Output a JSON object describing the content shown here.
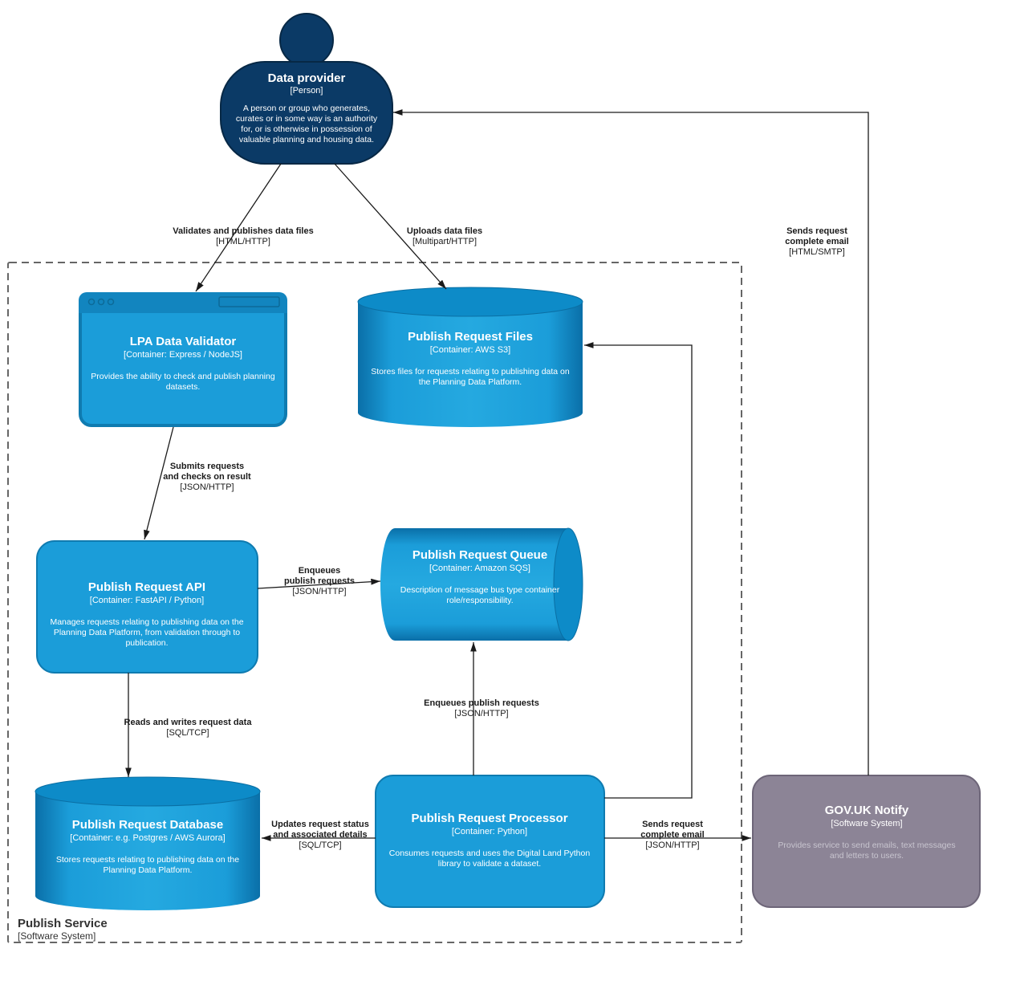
{
  "boundary": {
    "title": "Publish Service",
    "subtitle": "[Software System]"
  },
  "person": {
    "title": "Data provider",
    "subtitle": "[Person]",
    "desc1": "A person or group who generates,",
    "desc2": "curates or in some way is an authority",
    "desc3": "for, or is otherwise in possession of",
    "desc4": "valuable planning and housing data."
  },
  "validator": {
    "title": "LPA Data Validator",
    "subtitle": "[Container: Express / NodeJS]",
    "desc1": "Provides the ability to check and publish planning",
    "desc2": "datasets."
  },
  "files": {
    "title": "Publish Request Files",
    "subtitle": "[Container: AWS S3]",
    "desc1": "Stores files for requests relating to publishing data on",
    "desc2": "the Planning Data Platform."
  },
  "api": {
    "title": "Publish Request API",
    "subtitle": "[Container: FastAPI / Python]",
    "desc1": "Manages requests relating to publishing data on the",
    "desc2": "Planning Data Platform, from validation through to",
    "desc3": "publication."
  },
  "queue": {
    "title": "Publish Request Queue",
    "subtitle": "[Container: Amazon SQS]",
    "desc1": "Description of message bus type container",
    "desc2": "role/responsibility."
  },
  "db": {
    "title": "Publish Request Database",
    "subtitle": "[Container: e.g. Postgres / AWS Aurora]",
    "desc1": "Stores requests relating to publishing data on the",
    "desc2": "Planning Data Platform."
  },
  "processor": {
    "title": "Publish Request Processor",
    "subtitle": "[Container: Python]",
    "desc1": "Consumes requests and uses the Digital Land Python",
    "desc2": "library to validate a dataset."
  },
  "notify": {
    "title": "GOV.UK Notify",
    "subtitle": "[Software System]",
    "desc1": "Provides service to send emails, text messages",
    "desc2": "and letters to users."
  },
  "edges": {
    "validates": {
      "l1": "Validates and publishes data files",
      "l2": "[HTML/HTTP]"
    },
    "uploads": {
      "l1": "Uploads data files",
      "l2": "[Multipart/HTTP]"
    },
    "sendsEmail": {
      "l1": "Sends request",
      "l2": "complete email",
      "l3": "[HTML/SMTP]"
    },
    "submits": {
      "l1": "Submits requests",
      "l2": "and checks on result",
      "l3": "[JSON/HTTP]"
    },
    "enqueues": {
      "l1": "Enqueues",
      "l2": "publish requests",
      "l3": "[JSON/HTTP]"
    },
    "reads": {
      "l1": "Reads and writes request data",
      "l2": "[SQL/TCP]"
    },
    "enqueues2": {
      "l1": "Enqueues publish requests",
      "l2": "[JSON/HTTP]"
    },
    "updates": {
      "l1": "Updates request status",
      "l2": "and associated details",
      "l3": "[SQL/TCP]"
    },
    "sends2": {
      "l1": "Sends request",
      "l2": "complete email",
      "l3": "[JSON/HTTP]"
    }
  }
}
